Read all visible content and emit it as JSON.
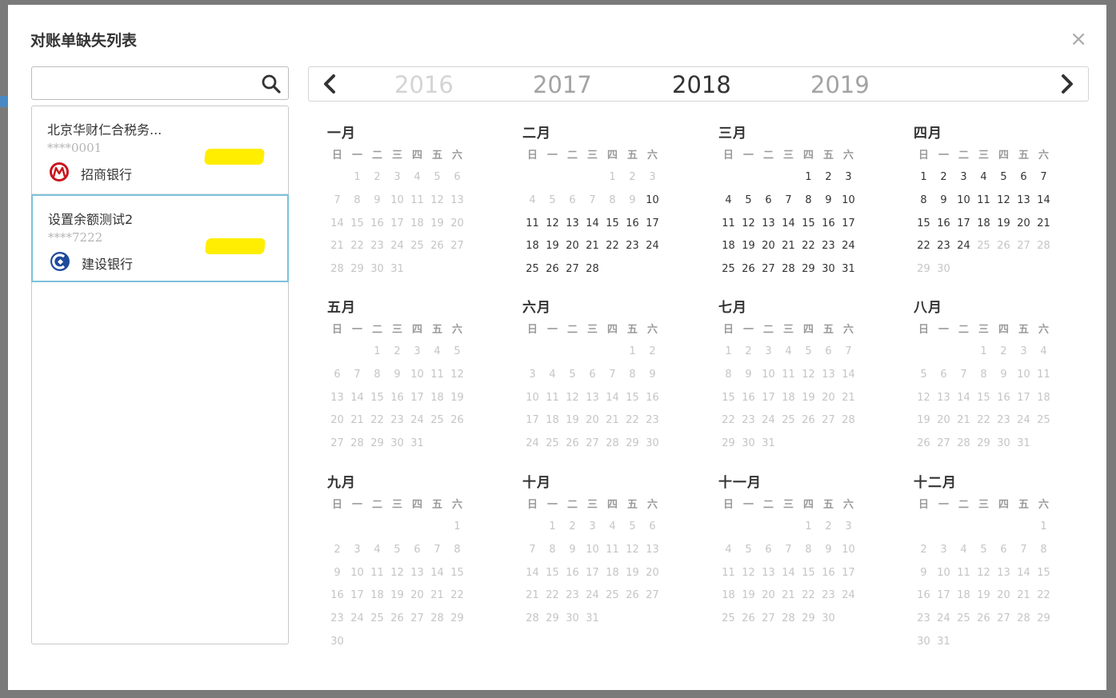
{
  "modal": {
    "title": "对账单缺失列表",
    "close_label": "×"
  },
  "search": {
    "placeholder": "",
    "value": ""
  },
  "accounts": [
    {
      "name": "北京华财仁合税务...",
      "number": "****0001",
      "bank": "招商银行",
      "bank_icon": "cmb-logo-icon",
      "selected": false
    },
    {
      "name": "设置余额测试2",
      "number": "****7222",
      "bank": "建设银行",
      "bank_icon": "ccb-logo-icon",
      "selected": true
    }
  ],
  "year_nav": {
    "years": [
      "2016",
      "2017",
      "2018",
      "2019"
    ],
    "current": "2018",
    "prev_icon": "chevron-left-icon",
    "next_icon": "chevron-right-icon"
  },
  "weekdays": [
    "日",
    "一",
    "二",
    "三",
    "四",
    "五",
    "六"
  ],
  "months": [
    {
      "name": "一月",
      "offset": 1,
      "days": 31,
      "missing_from": 0,
      "missing_to": 0
    },
    {
      "name": "二月",
      "offset": 4,
      "days": 28,
      "missing_from": 10,
      "missing_to": 28
    },
    {
      "name": "三月",
      "offset": 4,
      "days": 31,
      "missing_from": 1,
      "missing_to": 31
    },
    {
      "name": "四月",
      "offset": 0,
      "days": 30,
      "missing_from": 1,
      "missing_to": 24
    },
    {
      "name": "五月",
      "offset": 2,
      "days": 31,
      "missing_from": 0,
      "missing_to": 0
    },
    {
      "name": "六月",
      "offset": 5,
      "days": 30,
      "missing_from": 0,
      "missing_to": 0
    },
    {
      "name": "七月",
      "offset": 0,
      "days": 31,
      "missing_from": 0,
      "missing_to": 0
    },
    {
      "name": "八月",
      "offset": 3,
      "days": 31,
      "missing_from": 0,
      "missing_to": 0
    },
    {
      "name": "九月",
      "offset": 6,
      "days": 30,
      "missing_from": 0,
      "missing_to": 0
    },
    {
      "name": "十月",
      "offset": 1,
      "days": 31,
      "missing_from": 0,
      "missing_to": 0
    },
    {
      "name": "十一月",
      "offset": 4,
      "days": 30,
      "missing_from": 0,
      "missing_to": 0
    },
    {
      "name": "十二月",
      "offset": 6,
      "days": 31,
      "missing_from": 0,
      "missing_to": 0
    }
  ],
  "colors": {
    "selected_border": "#7cc2da",
    "active_day": "#333333",
    "inactive_day": "#c5c5c5",
    "highlight": "#ffee00",
    "cmb_red": "#c8161d",
    "ccb_blue": "#1e4a9c"
  }
}
